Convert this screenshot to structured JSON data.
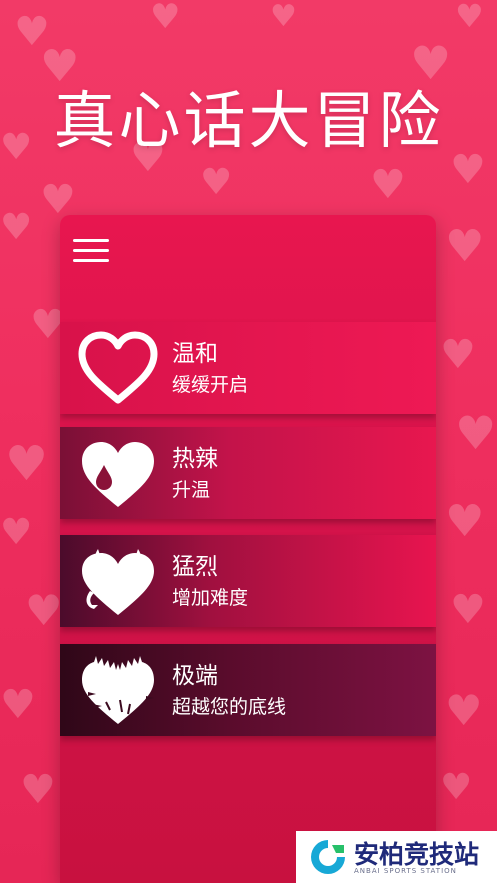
{
  "app": {
    "title": "真心话大冒险"
  },
  "menu": {
    "icon": "hamburger-menu-icon"
  },
  "levels": [
    {
      "name": "温和",
      "description": "缓缓开启",
      "icon": "outline-heart-icon"
    },
    {
      "name": "热辣",
      "description": "升温",
      "icon": "drop-heart-icon"
    },
    {
      "name": "猛烈",
      "description": "增加难度",
      "icon": "devil-heart-icon"
    },
    {
      "name": "极端",
      "description": "超越您的底线",
      "icon": "jagged-heart-icon"
    }
  ],
  "watermark": {
    "name": "安柏竞技站",
    "subtitle": "ANBAI SPORTS STATION"
  },
  "colors": {
    "background": "#ef2f5f",
    "panel": "#d3134a",
    "text": "#ffffff"
  }
}
